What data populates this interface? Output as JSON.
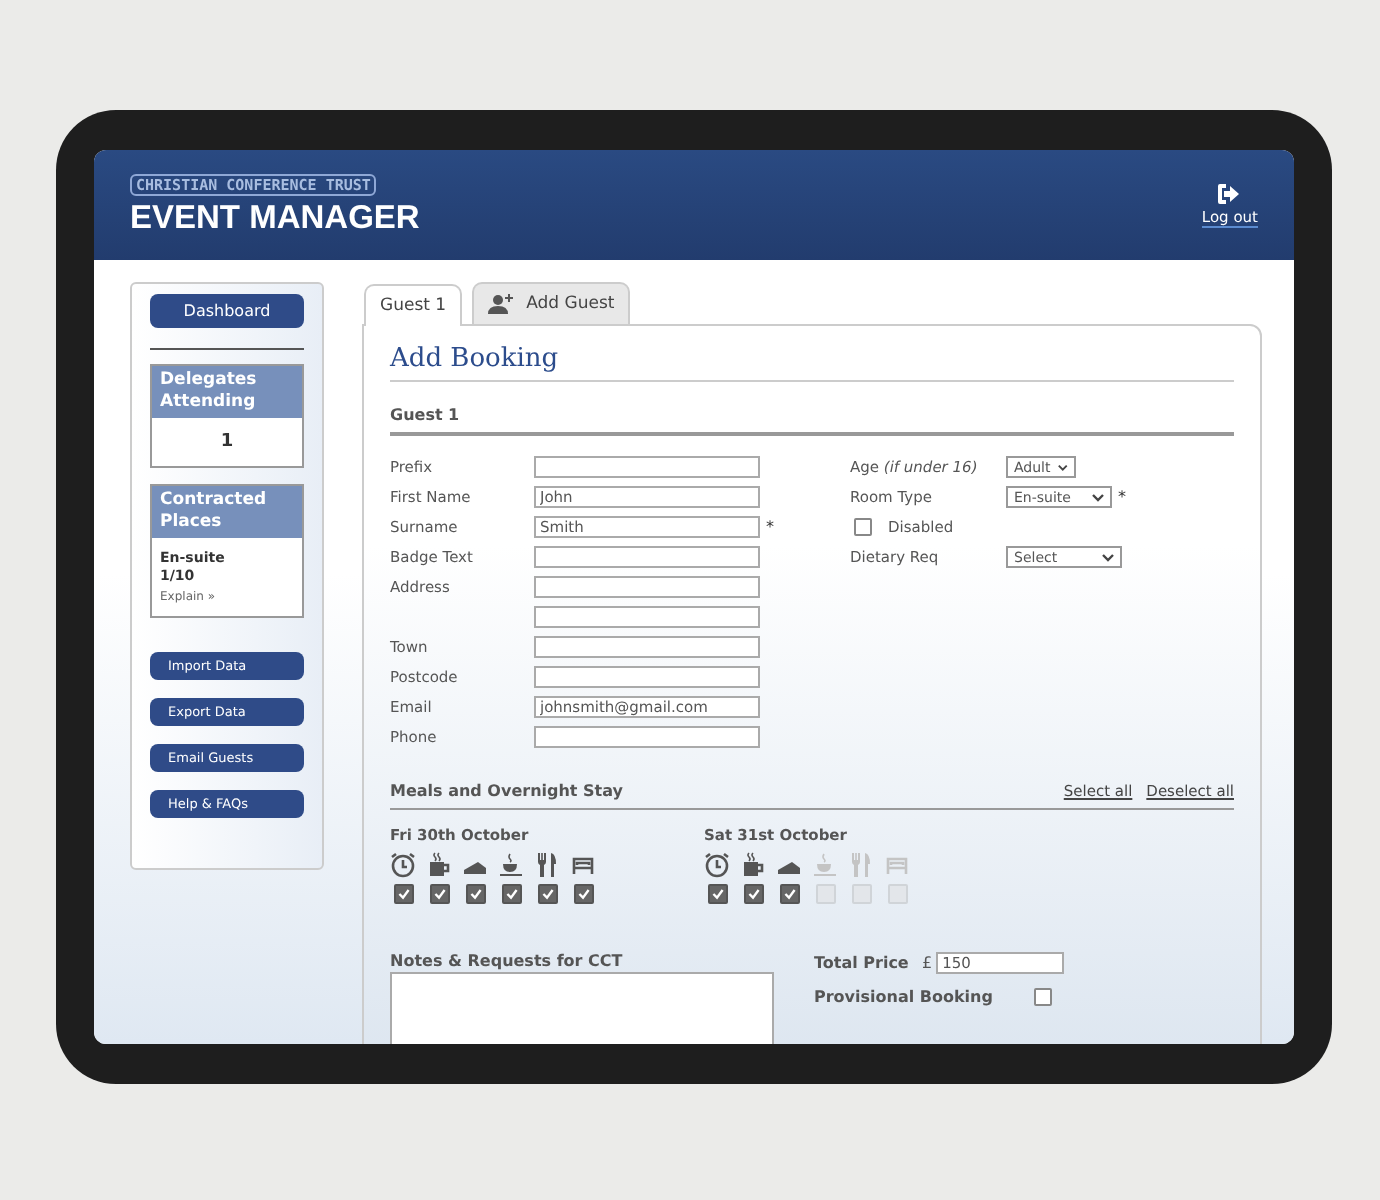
{
  "header": {
    "org": "CHRISTIAN CONFERENCE TRUST",
    "app": "EVENT MANAGER",
    "logout": "Log out"
  },
  "sidebar": {
    "dashboard": "Dashboard",
    "delegates": {
      "title": "Delegates Attending",
      "value": "1"
    },
    "contracted": {
      "title": "Contracted Places",
      "type": "En-suite",
      "count": "1/10",
      "link": "Explain »"
    },
    "buttons": [
      "Import Data",
      "Export Data",
      "Email Guests",
      "Help & FAQs"
    ]
  },
  "tabs": [
    {
      "label": "Guest 1",
      "selected": true,
      "kind": "guest"
    },
    {
      "label": "Add Guest",
      "selected": false,
      "kind": "add"
    }
  ],
  "form": {
    "title": "Add Booking",
    "section": "Guest 1",
    "fields": [
      {
        "label": "Prefix"
      },
      {
        "label": "First Name",
        "value": "John"
      },
      {
        "label": "Surname",
        "value": "Smith",
        "mark": "*"
      },
      {
        "label": "Badge Text"
      },
      {
        "label": "Address"
      },
      {
        "kind": "continuation"
      },
      {
        "label": "Town"
      },
      {
        "label": "Postcode"
      },
      {
        "label": "Email",
        "value": "johnsmith@gmail.com"
      },
      {
        "label": "Phone"
      }
    ],
    "right": [
      {
        "kind": "select",
        "label": "Age *(if under 16)*",
        "value": "Adult"
      },
      {
        "kind": "select",
        "label": "Room Type",
        "value": "En-suite",
        "mark": "*"
      },
      {
        "kind": "checkbox",
        "label": "Disabled",
        "checked": false
      },
      {
        "kind": "select",
        "label": "Dietary Req",
        "value": "Select"
      }
    ]
  },
  "meals": {
    "title": "Meals and Overnight Stay",
    "select_all": "Select all",
    "deselect_all": "Deselect all",
    "days": [
      {
        "date": "Fri 30th October",
        "items": [
          {
            "kind": "alarm",
            "checked": true,
            "disabled": false
          },
          {
            "kind": "mug",
            "checked": true,
            "disabled": false
          },
          {
            "kind": "cake",
            "checked": true,
            "disabled": false
          },
          {
            "kind": "cup",
            "checked": true,
            "disabled": false
          },
          {
            "kind": "cutlery",
            "checked": true,
            "disabled": false
          },
          {
            "kind": "bed",
            "checked": true,
            "disabled": false
          }
        ]
      },
      {
        "date": "Sat 31st October",
        "items": [
          {
            "kind": "alarm",
            "checked": true,
            "disabled": false
          },
          {
            "kind": "mug",
            "checked": true,
            "disabled": false
          },
          {
            "kind": "cake",
            "checked": true,
            "disabled": false
          },
          {
            "kind": "cup",
            "checked": false,
            "disabled": true
          },
          {
            "kind": "cutlery",
            "checked": false,
            "disabled": true
          },
          {
            "kind": "bed",
            "checked": false,
            "disabled": true
          }
        ]
      }
    ]
  },
  "notes": {
    "label": "Notes & Requests for CCT"
  },
  "price": {
    "label": "Total Price",
    "currency": "£",
    "value": "150"
  },
  "provisional": {
    "label": "Provisional Booking",
    "checked": false
  }
}
